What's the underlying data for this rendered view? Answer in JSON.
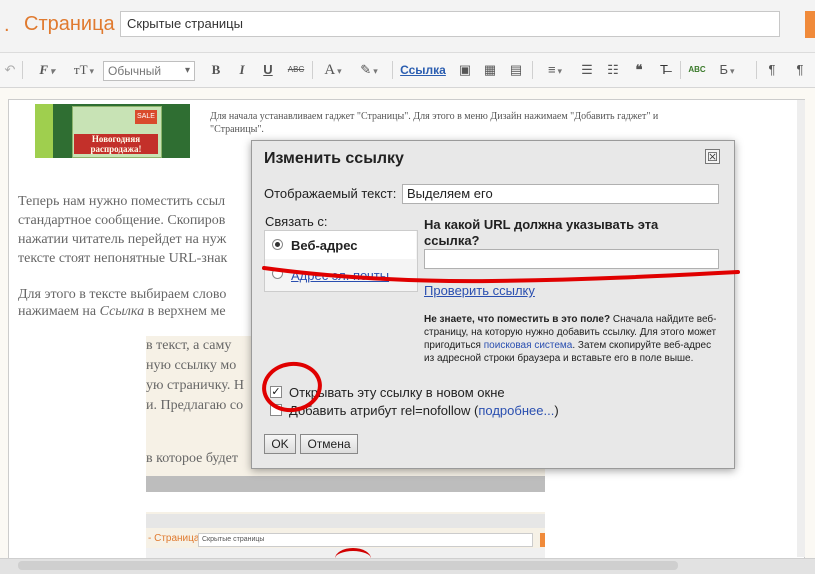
{
  "header": {
    "dot": ".",
    "breadcrumb": "Страница",
    "page_title_value": "Скрытые страницы"
  },
  "toolbar": {
    "font_label": "Обычный",
    "bold": "B",
    "italic": "I",
    "underline": "U",
    "strike": "ABC",
    "text_color": "A",
    "link": "Ссылка",
    "spell": "ABC",
    "rtl_b": "Б",
    "para_ltr": "¶",
    "para_rtl": "¶",
    "icons": [
      "undo-icon",
      "font-family-icon",
      "font-size-icon",
      "text-color-icon",
      "highlight-icon",
      "image-icon",
      "video-icon",
      "jump-break-icon",
      "align-icon",
      "numbered-list-icon",
      "bullet-list-icon",
      "quote-icon",
      "clear-format-icon",
      "spellcheck-icon"
    ]
  },
  "article": {
    "small_line1": "Для начала устанавливаем гаджет \"Страницы\". Для этого в меню Дизайн нажимаем \"Добавить гаджет\" и",
    "small_line2": "\"Страницы\".",
    "thumb_text": "Новогодняя распродажа!",
    "thumb_tag": "SALE",
    "p1_l1": "Теперь нам нужно поместить ссыл",
    "p1_l2": "стандартное сообщение. Скопиров",
    "p1_l3": "нажатии читатель перейдет на нуж",
    "p1_l4": "тексте стоят непонятные URL-знак",
    "p2_l1": "Для этого в тексте выбираем слово",
    "p2_l2a": "нажимаем на ",
    "p2_l2b": "Ссылка",
    "p2_l2c": " в верхнем ме",
    "s1": "в текст, а саму",
    "s2": "ную ссылку мо",
    "s3": "ую страничку. Н",
    "s4": "и. Предлагаю со",
    "s5": "в которое будет",
    "shot_crumb": "- Страница",
    "shot_input": "Скрытые страницы"
  },
  "dialog": {
    "title": "Изменить ссылку",
    "close": "☒",
    "display_text_label": "Отображаемый текст:",
    "display_text_value": "Выделяем его",
    "link_to_label": "Связать с:",
    "option_web": "Веб-адрес",
    "option_email": "Адрес эл. почты",
    "url_question": "На какой URL должна указывать эта ссылка?",
    "url_value": "",
    "check_link": "Проверить ссылку",
    "help_bold": "Не знаете, что поместить в это поле?",
    "help_1": " Сначала найдите веб-страницу, на которую нужно добавить ссылку. Для этого может пригодиться ",
    "help_link": "поисковая система",
    "help_2": ". Затем скопируйте веб-адрес из адресной строки браузера и вставьте его в поле выше.",
    "open_new_window": "Открывать эту ссылку в новом окне",
    "open_new_window_checked": true,
    "nofollow_1": "Добавить атрибут rel=nofollow (",
    "nofollow_link": "подробнее...",
    "nofollow_2": ")",
    "ok": "OK",
    "cancel": "Отмена"
  }
}
